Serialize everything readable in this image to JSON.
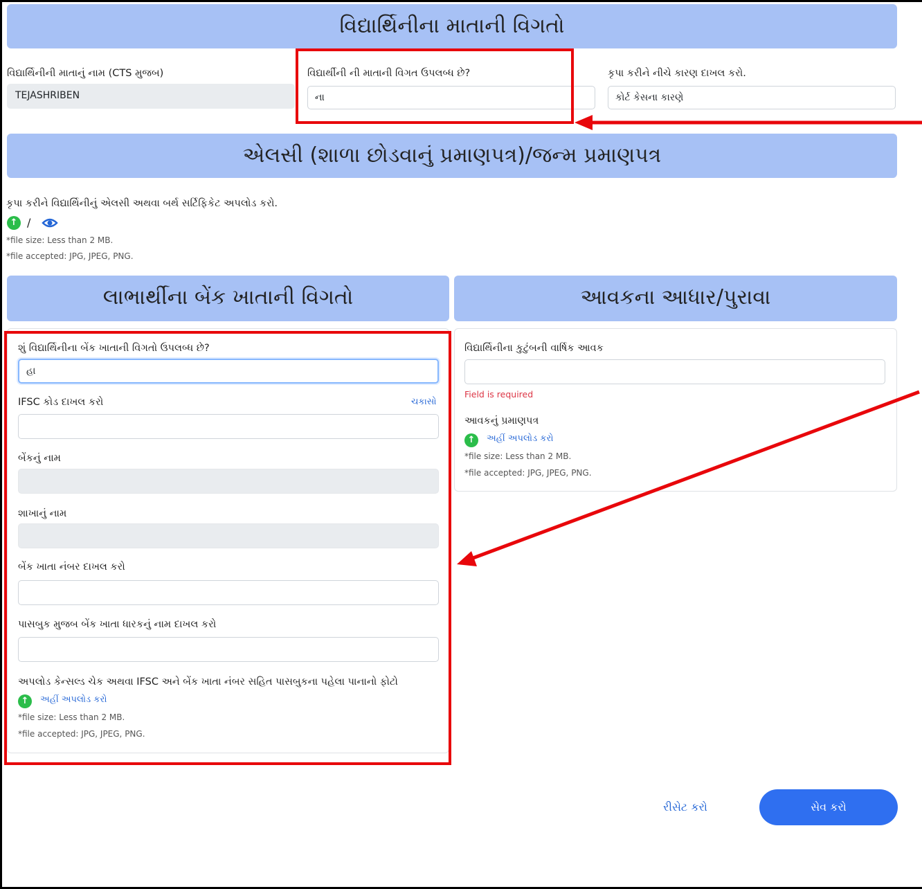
{
  "mother_section": {
    "title": "વિદ્યાર્થિનીના માતાની વિગતો",
    "name_label": "વિદ્યાર્થિનીની માતાનું નામ (CTS મુજબ)",
    "name_value": "TEJASHRIBEN",
    "available_label": "વિદ્યાર્થીની ની માતાની વિગત ઉપલબ્ધ છે?",
    "available_value": "ના",
    "reason_label": "કૃપા કરીને નીચે કારણ દાખલ કરો.",
    "reason_value": "કોર્ટ કેસના કારણે"
  },
  "lc_section": {
    "title": "એલસી (શાળા છોડવાનું પ્રમાણપત્ર)/જન્મ પ્રમાણપત્ર",
    "upload_label": "કૃપા કરીને વિદ્યાર્થિનીનું એલસી અથવા બર્થ સર્ટિફિકેટ અપલોડ કરો.",
    "separator": "/",
    "file_size": "*file size: Less than 2 MB.",
    "file_accepted": "*file accepted: JPG, JPEG, PNG."
  },
  "bank_section": {
    "title": "લાભાર્થીના બેંક ખાતાની વિગતો",
    "available_label": "શું વિદ્યાર્થિનીના બેંક ખાતાની વિગતો ઉપલબ્ધ છે?",
    "available_value": "હા",
    "ifsc_label": "IFSC કોડ દાખલ કરો",
    "ifsc_check": "ચકાસો",
    "ifsc_value": "",
    "bank_name_label": "બેંકનું નામ",
    "bank_name_value": "",
    "branch_label": "શાખાનું નામ",
    "branch_value": "",
    "account_label": "બેંક ખાતા નંબર દાખલ કરો",
    "account_value": "",
    "holder_label": "પાસબુક મુજબ બેંક ખાતા ધારકનું નામ દાખલ કરો",
    "holder_value": "",
    "upload_label": "અપલોડ કેન્સલ્ડ ચેક અથવા IFSC અને બેંક ખાતા નંબર સહિત પાસબુકના પહેલા પાનાનો ફોટો",
    "upload_link": "અહીં અપલોડ કરો",
    "file_size": "*file size: Less than 2 MB.",
    "file_accepted": "*file accepted: JPG, JPEG, PNG."
  },
  "income_section": {
    "title": "આવકના આધાર/પુરાવા",
    "income_label": "વિદ્યાર્થિનીના કુટુંબની વાર્ષિક આવક",
    "income_value": "",
    "error": "Field is required",
    "certificate_label": "આવકનું પ્રમાણપત્ર",
    "upload_link": "અહીં અપલોડ કરો",
    "file_size": "*file size: Less than 2 MB.",
    "file_accepted": "*file accepted: JPG, JPEG, PNG."
  },
  "actions": {
    "reset": "રીસેટ કરો",
    "save": "સેવ કરો"
  },
  "colors": {
    "header_bg": "#a7c1f5",
    "annotation": "#e8070b",
    "primary": "#2f6ff0",
    "upload_icon": "#2bbd4a"
  }
}
